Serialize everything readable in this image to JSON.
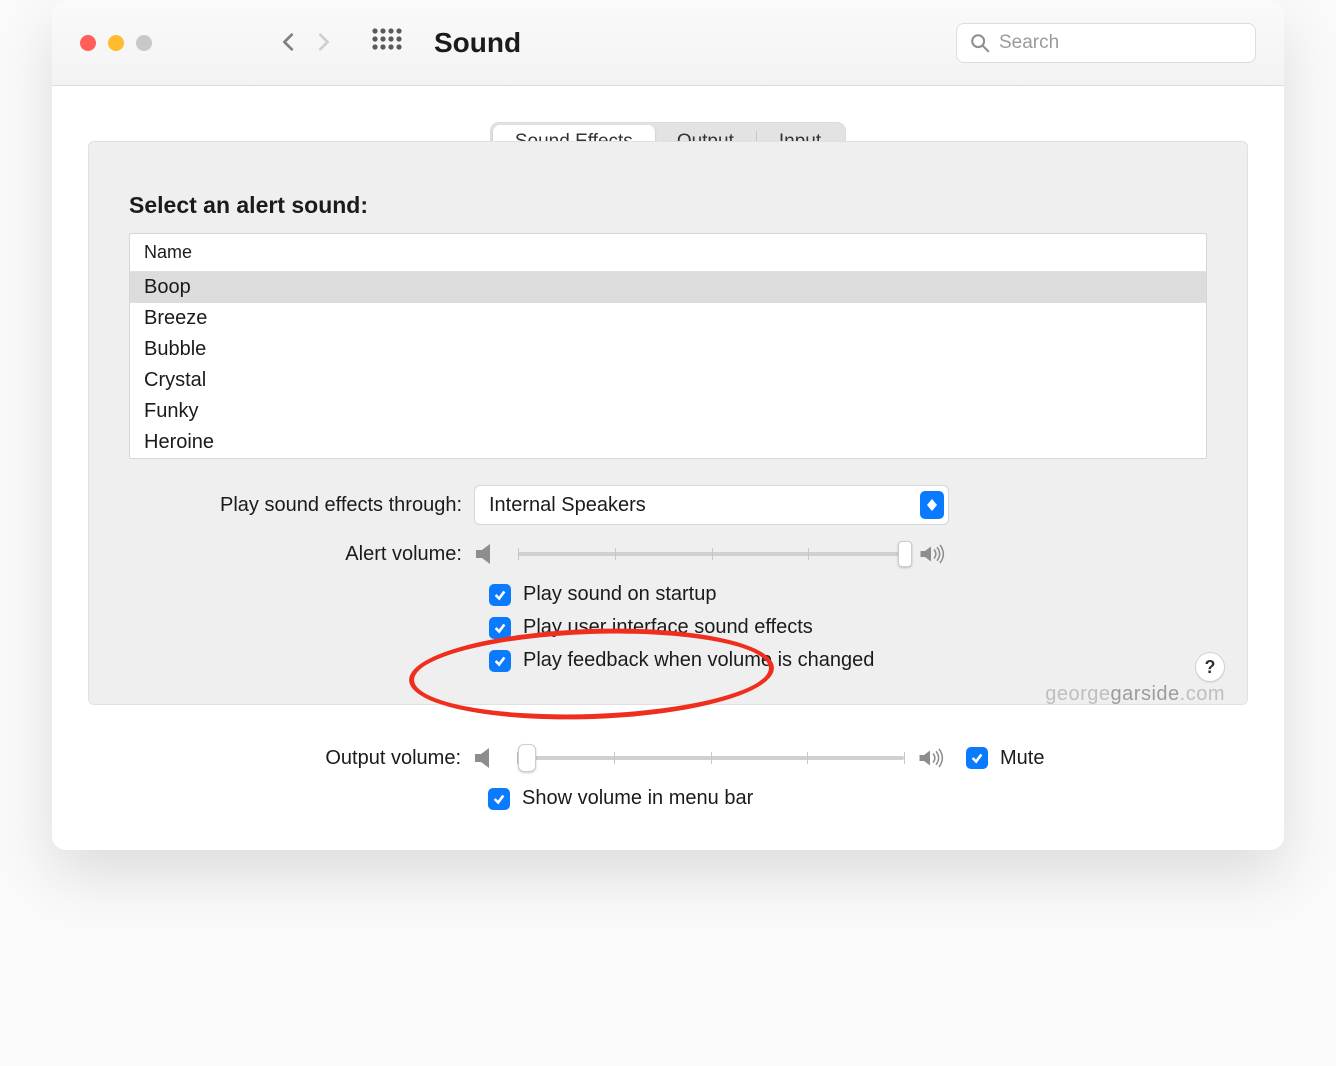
{
  "toolbar": {
    "title": "Sound",
    "search_placeholder": "Search"
  },
  "tabs": {
    "items": [
      "Sound Effects",
      "Output",
      "Input"
    ],
    "active": 0
  },
  "panel": {
    "heading": "Select an alert sound:",
    "column_header": "Name",
    "sounds": [
      "Boop",
      "Breeze",
      "Bubble",
      "Crystal",
      "Funky",
      "Heroine"
    ],
    "selected_index": 0,
    "play_through_label": "Play sound effects through:",
    "play_through_value": "Internal Speakers",
    "alert_volume_label": "Alert volume:",
    "alert_volume_percent": 100,
    "checkboxes": {
      "startup": {
        "label": "Play sound on startup",
        "checked": true
      },
      "ui_effects": {
        "label": "Play user interface sound effects",
        "checked": true
      },
      "feedback": {
        "label": "Play feedback when volume is changed",
        "checked": true
      }
    },
    "help_label": "?"
  },
  "below": {
    "output_volume_label": "Output volume:",
    "output_volume_percent": 2,
    "mute": {
      "label": "Mute",
      "checked": true
    },
    "show_menu_bar": {
      "label": "Show volume in menu bar",
      "checked": true
    }
  },
  "watermark": {
    "part1": "george",
    "part2": "garside",
    "part3": ".com"
  }
}
